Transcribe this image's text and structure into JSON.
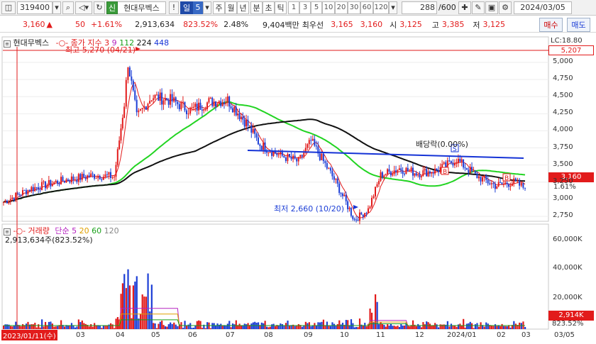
{
  "toolbar": {
    "code": "319400",
    "credit_badge": "신",
    "stock_name": "현대무벡스",
    "period_unit": "일",
    "period_count": "5",
    "periods": [
      "주",
      "월",
      "년",
      "분",
      "초",
      "틱"
    ],
    "minute_options": [
      "1",
      "3",
      "5",
      "10",
      "20",
      "30",
      "60",
      "120"
    ],
    "count_display": "288",
    "count_total": "/600",
    "date": "2024/03/05"
  },
  "quote": {
    "price": "3,160",
    "arrow": "▲",
    "change": "50",
    "change_pct": "+1.61%",
    "volume": "2,913,634",
    "volume_ratio": "823.52%",
    "turnover": "2.48%",
    "amount": "9,404백만",
    "preferred_label": "최우선",
    "ask": "3,165",
    "bid": "3,160",
    "open_label": "시",
    "open": "3,125",
    "high_label": "고",
    "high": "3,385",
    "low_label": "저",
    "low": "3,125",
    "buy_button": "매수",
    "sell_button": "매도"
  },
  "price_panel": {
    "title": "현대무벡스",
    "ma_legend_prefix": "종가 지수",
    "ma_periods": [
      "3",
      "9",
      "112",
      "224",
      "448"
    ],
    "lc_label": "LC:18.80",
    "upper_line_value": "5,207",
    "current_price_tag": "3,160",
    "current_pct_tag": "1.61%",
    "high_annotation": "최고 5,270 (04/21)",
    "low_annotation": "최저 2,660 (10/20)",
    "dividend_annotation": "배당락(0.00%)",
    "y_ticks": [
      "5,000",
      "4,750",
      "4,500",
      "4,250",
      "4,000",
      "3,750",
      "3,500",
      "3,250",
      "3,000",
      "2,750"
    ]
  },
  "volume_panel": {
    "title": "거래량",
    "ma_prefix": "단순",
    "ma_periods": [
      "5",
      "20",
      "60",
      "120"
    ],
    "current_volume": "2,913,634주(823.52%)",
    "volume_tag": "2,914K",
    "ratio_tag": "823.52%",
    "y_ticks": [
      "60,000K",
      "40,000K",
      "20,000K"
    ]
  },
  "x_axis": {
    "start_label": "2023/01/11(수)",
    "months": [
      "03",
      "04",
      "05",
      "06",
      "07",
      "08",
      "09",
      "10",
      "11",
      "12",
      "2024/01",
      "02",
      "03"
    ],
    "end_label": "03/05"
  },
  "colors": {
    "up": "#e21b1b",
    "down": "#1d3fd6",
    "ma_green": "#22d422",
    "ma_black": "#111111",
    "ma_blue": "#1533d6"
  },
  "chart_data": {
    "type": "candlestick",
    "price_range": [
      2600,
      5300
    ],
    "close_series_approx": [
      [
        "2023-01-11",
        2960
      ],
      [
        "2023-02-01",
        3150
      ],
      [
        "2023-03-01",
        3280
      ],
      [
        "2023-03-25",
        3350
      ],
      [
        "2023-04-10",
        3330
      ],
      [
        "2023-04-18",
        4400
      ],
      [
        "2023-04-21",
        5000
      ],
      [
        "2023-04-28",
        4200
      ],
      [
        "2023-05-10",
        4500
      ],
      [
        "2023-05-25",
        4450
      ],
      [
        "2023-06-10",
        4300
      ],
      [
        "2023-06-25",
        4420
      ],
      [
        "2023-07-10",
        4450
      ],
      [
        "2023-07-25",
        4120
      ],
      [
        "2023-08-05",
        3800
      ],
      [
        "2023-08-20",
        3650
      ],
      [
        "2023-09-05",
        3550
      ],
      [
        "2023-09-15",
        3850
      ],
      [
        "2023-09-25",
        3550
      ],
      [
        "2023-10-05",
        3250
      ],
      [
        "2023-10-20",
        2700
      ],
      [
        "2023-10-31",
        2850
      ],
      [
        "2023-11-10",
        3350
      ],
      [
        "2023-11-25",
        3450
      ],
      [
        "2023-12-10",
        3380
      ],
      [
        "2023-12-25",
        3420
      ],
      [
        "2024-01-10",
        3580
      ],
      [
        "2024-01-25",
        3350
      ],
      [
        "2024-02-10",
        3200
      ],
      [
        "2024-02-25",
        3250
      ],
      [
        "2024-03-05",
        3160
      ]
    ],
    "volume_max": 65000
  }
}
